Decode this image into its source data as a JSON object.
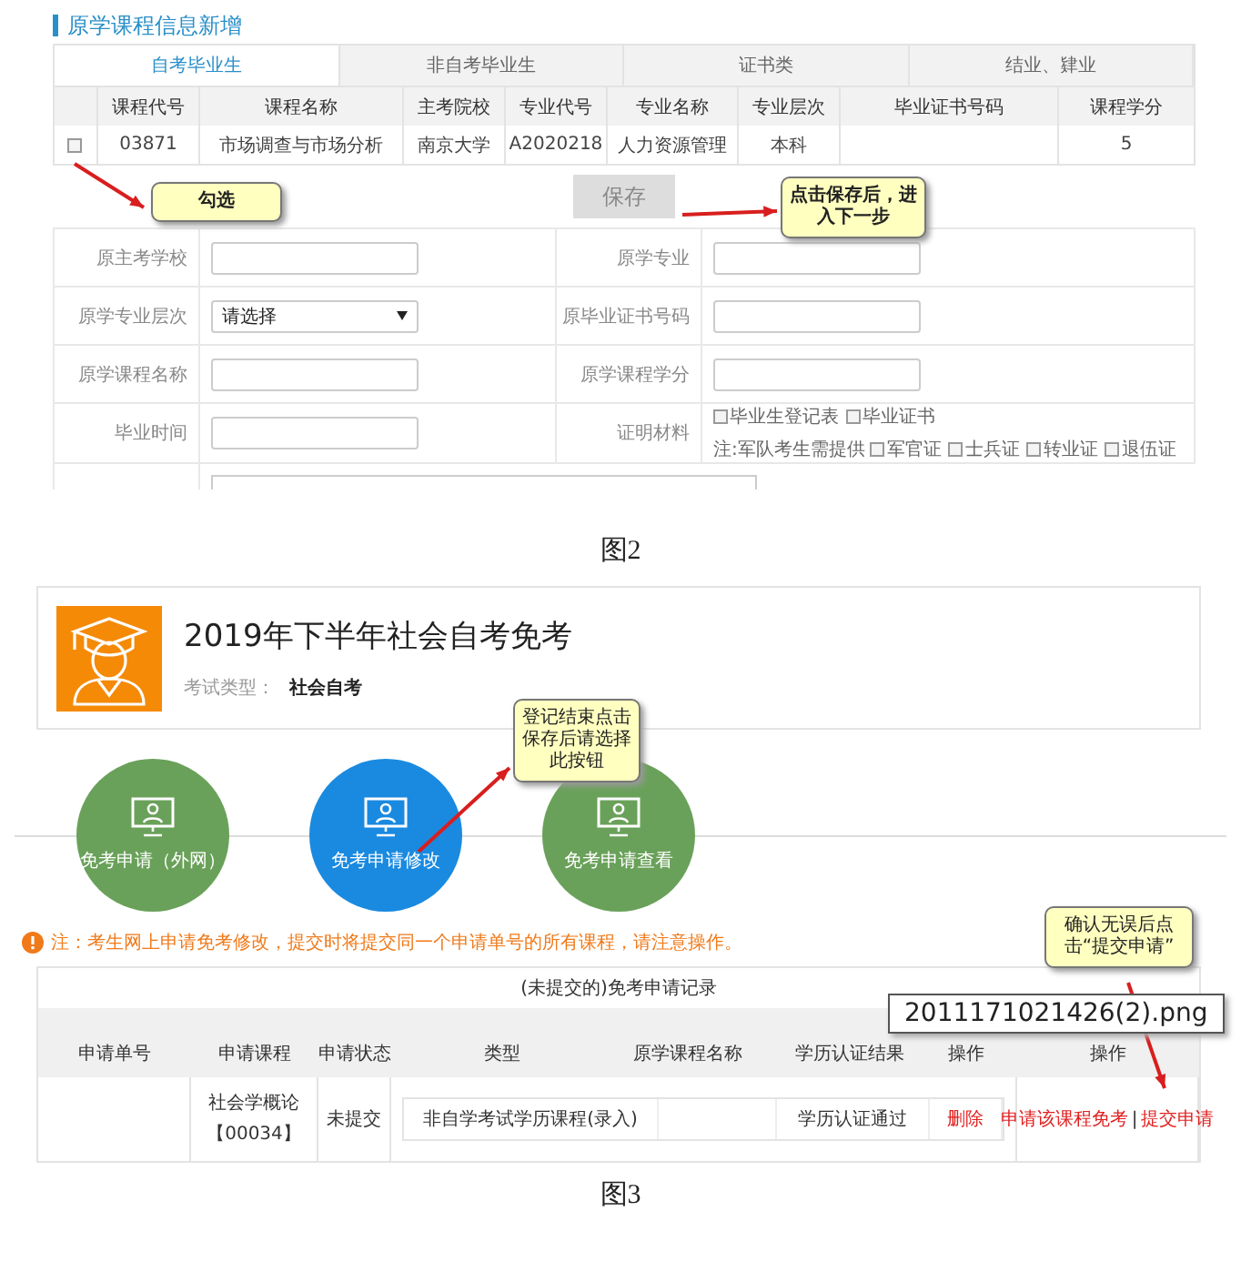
{
  "figure_2": {
    "section_title": "原学课程信息新增",
    "tabs": [
      {
        "label": "自考毕业生",
        "selected": true
      },
      {
        "label": "非自考毕业生",
        "selected": false
      },
      {
        "label": "证书类",
        "selected": false
      },
      {
        "label": "结业、肄业",
        "selected": false
      }
    ],
    "table": {
      "columns": [
        "课程代号",
        "课程名称",
        "主考院校",
        "专业代号",
        "专业名称",
        "专业层次",
        "毕业证书号码",
        "课程学分"
      ],
      "rows": [
        {
          "checked": false,
          "code": "03871",
          "name": "市场调查与市场分析",
          "school": "南京大学",
          "major_code": "A2020218",
          "major_name": "人力资源管理",
          "degree": "本科",
          "credits": "5"
        }
      ]
    },
    "save_button": "保存",
    "callouts": [
      "勾选",
      "点击保存后，进入下一步"
    ],
    "form": [
      {
        "left": {
          "label": "原主考学校",
          "kind": "input"
        },
        "right": {
          "label": "原学专业",
          "kind": "input"
        }
      },
      {
        "left": {
          "label": "原学专业层次",
          "kind": "select",
          "value": "请选择"
        },
        "right": {
          "label": "原毕业证书号码",
          "kind": "input"
        }
      },
      {
        "left": {
          "label": "原学课程名称",
          "kind": "input"
        },
        "right": {
          "label": "原学课程学分",
          "kind": "input"
        }
      },
      {
        "left": {
          "label": "毕业时间",
          "kind": "input"
        },
        "right": {
          "label": "证明材料",
          "kind": "checks",
          "options": [
            {
              "label": "毕业生登记表",
              "checked": false
            },
            {
              "label": "毕业证书",
              "checked": false
            }
          ],
          "note": "注:军队考生需提供",
          "note_options": [
            {
              "label": "军官证",
              "checked": false
            },
            {
              "label": "士兵证",
              "checked": false
            },
            {
              "label": "转业证",
              "checked": false
            },
            {
              "label": "退伍证",
              "checked": false
            }
          ]
        }
      }
    ],
    "caption": "图2"
  },
  "figure_3": {
    "exam_title": "2019年下半年社会自考免考",
    "type_label": "考试类型：",
    "type_value": "社会自考",
    "steps": [
      {
        "label": "免考申请（外网）",
        "selected": false
      },
      {
        "label": "免考申请修改",
        "selected": true
      },
      {
        "label": "免考申请查看",
        "selected": false
      }
    ],
    "step_callout": "登记结束点击保存后请选择此按钮",
    "notice": "注：考生网上申请免考修改，提交时将提交同一个申请单号的所有课程，请注意操作。",
    "table": {
      "title": "(未提交的)免考申请记录",
      "columns": [
        "申请单号",
        "申请课程",
        "申请状态"
      ],
      "inner_columns": [
        "类型",
        "原学课程名称",
        "学历认证结果",
        "操作"
      ],
      "action_column": "操作",
      "rows": [
        {
          "course": "社会学概论",
          "course_code": "【00034】",
          "status": "未提交",
          "type": "非自学考试学历课程(录入)",
          "result": "学历认证通过",
          "delete": "删除",
          "apply_link": "申请该课程免考",
          "separator": "|",
          "submit_link": "提交申请"
        }
      ]
    },
    "submit_callout": "确认无误后点击“提交申请”",
    "file_tooltip": "2011171021426(2).png",
    "caption": "图3"
  }
}
